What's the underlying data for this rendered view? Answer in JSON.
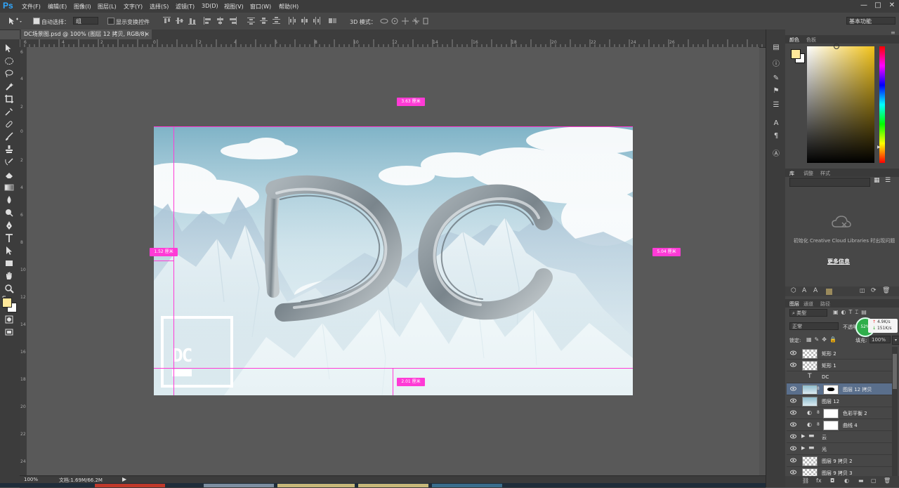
{
  "app": {
    "logo_text": "Ps",
    "menu": [
      "文件(F)",
      "编辑(E)",
      "图像(I)",
      "图层(L)",
      "文字(Y)",
      "选择(S)",
      "滤镜(T)",
      "3D(D)",
      "视图(V)",
      "窗口(W)",
      "帮助(H)"
    ],
    "window_controls": [
      "—",
      "□",
      "✕"
    ]
  },
  "options_bar": {
    "auto_select_label": "自动选择：",
    "auto_select_value": "组",
    "show_transform_label": "显示变换控件",
    "mode_3d_label": "3D 模式：",
    "workspace": "基本功能"
  },
  "document": {
    "tab_title": "DC场景图.psd @ 100% (图层 12 拷贝, RGB/8)",
    "tab_close": "×",
    "zoom": "100%",
    "doc_info": "文档:1.69M/66.2M"
  },
  "canvas": {
    "logo_text": "DC",
    "measurements": [
      "3.63 厘米",
      "1.52 厘米",
      "5.04 厘米",
      "2.01 厘米"
    ],
    "guide_color": "#ff3bd6"
  },
  "ruler_top_ticks": [
    "6",
    "4",
    "2",
    "0",
    "2",
    "4",
    "6",
    "8",
    "10",
    "12",
    "14",
    "16",
    "18",
    "20",
    "22",
    "24",
    "26"
  ],
  "ruler_left_ticks": [
    "6",
    "4",
    "2",
    "0",
    "2",
    "4",
    "6",
    "8",
    "10",
    "12",
    "14",
    "16",
    "18",
    "20",
    "22",
    "24"
  ],
  "panels": {
    "color_tabs": [
      "颜色",
      "色板"
    ],
    "library_tabs": [
      "库",
      "调整",
      "样式"
    ],
    "library_message": "初始化 Creative Cloud Libraries 时出现问题",
    "library_more": "更多信息",
    "layers_tabs": [
      "图层",
      "通道",
      "路径"
    ],
    "filter_kind": "类型",
    "blend_mode": "正常",
    "opacity_label": "不透明",
    "lock_label": "锁定:",
    "fill_label": "填充:",
    "fill_value": "100%",
    "net_percent": "52%",
    "net_up": "4.9K/s",
    "net_down": "151K/s",
    "layers": [
      {
        "name": "矩形 2",
        "type": "shape",
        "selected": false
      },
      {
        "name": "矩形 1",
        "type": "shape",
        "selected": false
      },
      {
        "name": "DC",
        "type": "text",
        "selected": false
      },
      {
        "name": "图层 12 拷贝",
        "type": "image-mask",
        "selected": true
      },
      {
        "name": "图层 12",
        "type": "image",
        "selected": false
      },
      {
        "name": "色彩平衡 2",
        "type": "adjustment",
        "selected": false
      },
      {
        "name": "曲线 4",
        "type": "adjustment",
        "selected": false
      },
      {
        "name": "云",
        "type": "group",
        "selected": false
      },
      {
        "name": "光",
        "type": "group",
        "selected": false
      },
      {
        "name": "图层 9 拷贝 2",
        "type": "pixel",
        "selected": false
      },
      {
        "name": "图层 9 拷贝 3",
        "type": "pixel",
        "selected": false
      }
    ]
  },
  "colors": {
    "foreground": "#ffe89a",
    "background": "#ffffff",
    "picker_hue": "#f2c31a",
    "ui_dark": "#3c3c3c",
    "ui_panel": "#474747",
    "canvas_bg": "#595959",
    "selection_blue": "#5a6f8c"
  }
}
